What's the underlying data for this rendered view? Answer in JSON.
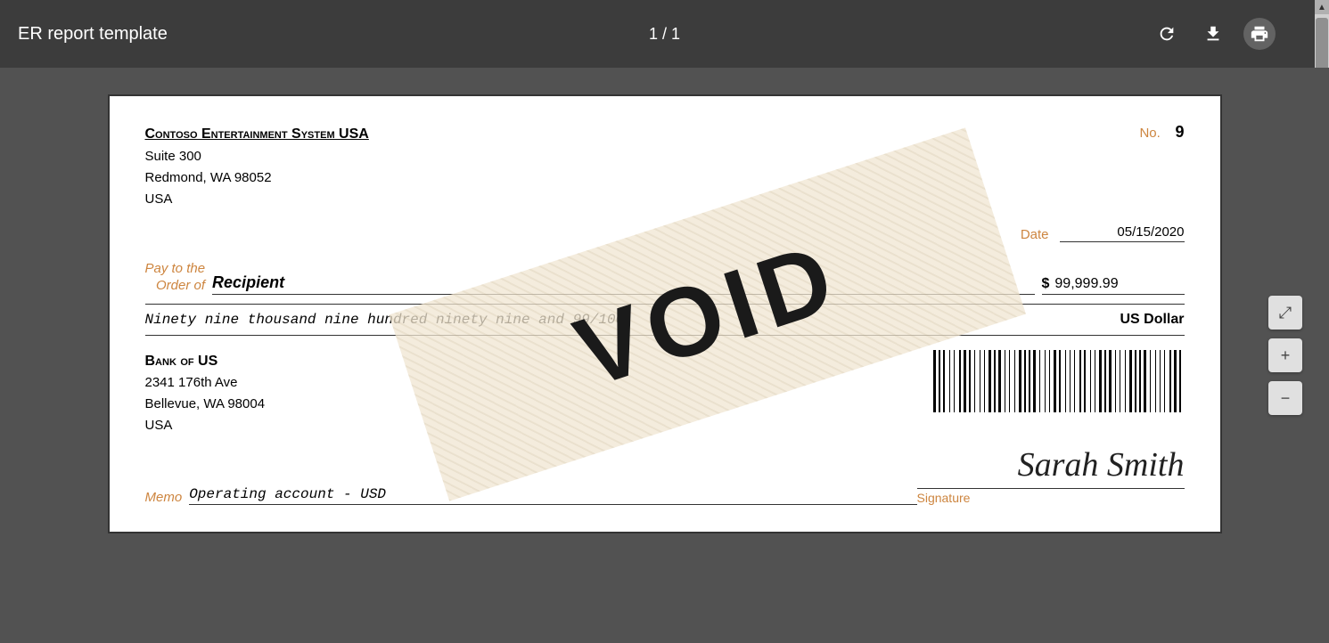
{
  "toolbar": {
    "title": "ER report template",
    "page_info": "1 / 1",
    "refresh_icon": "↺",
    "download_icon": "⬇",
    "print_icon": "🖶"
  },
  "check": {
    "company_name": "Contoso Entertainment System USA",
    "address_line1": "Suite 300",
    "address_line2": "Redmond, WA 98052",
    "address_line3": "USA",
    "check_number_label": "No.",
    "check_number_value": "9",
    "date_label": "Date",
    "date_value": "05/15/2020",
    "payto_label_line1": "Pay to the",
    "payto_label_line2": "Order of",
    "recipient": "Recipient",
    "dollar_sign": "$",
    "amount": "99,999.99",
    "written_amount": "Ninety nine thousand nine hundred ninety nine and 99/100",
    "currency": "US Dollar",
    "bank_name": "Bank of US",
    "bank_address1": "2341 176th Ave",
    "bank_address2": "Bellevue, WA 98004",
    "bank_address3": "USA",
    "memo_label": "Memo",
    "memo_value": "Operating account - USD",
    "signature_label": "Signature",
    "signature_name": "Sarah Smith",
    "void_text": "VOID"
  },
  "side_controls": {
    "fit_icon": "⤢",
    "zoom_in_icon": "+",
    "zoom_out_icon": "−"
  }
}
